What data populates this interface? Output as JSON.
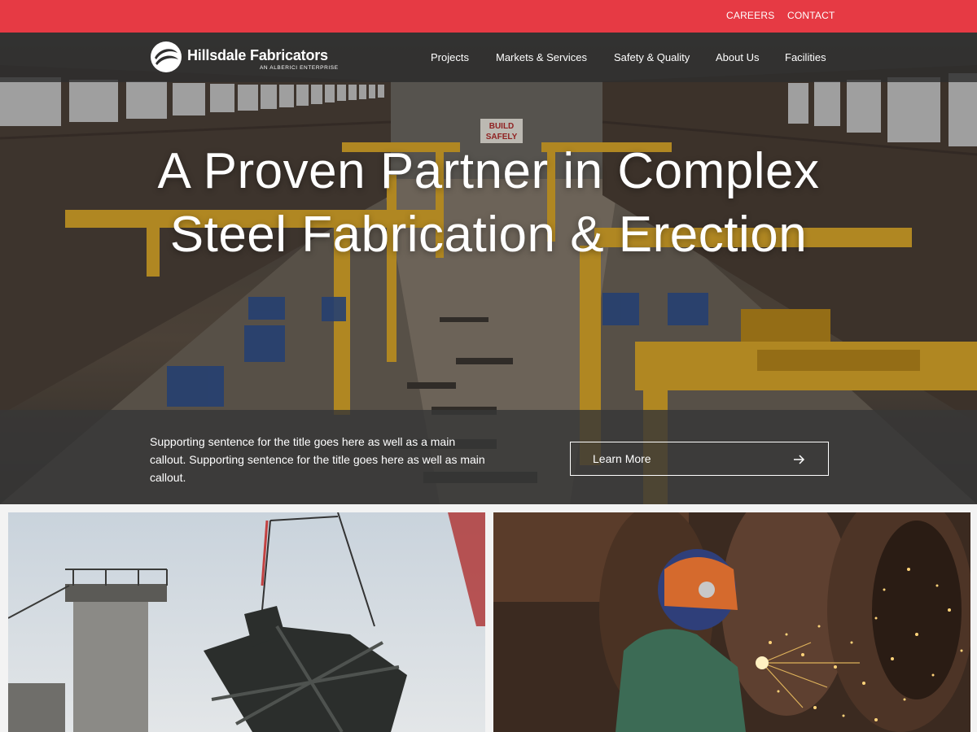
{
  "utility": {
    "links": [
      "CAREERS",
      "CONTACT"
    ]
  },
  "header": {
    "logo_name": "Hillsdale Fabricators",
    "logo_tagline": "AN ALBERICI ENTERPRISE",
    "nav": [
      "Projects",
      "Markets & Services",
      "Safety & Quality",
      "About Us",
      "Facilities"
    ]
  },
  "hero": {
    "title_line1": "A Proven Partner in Complex",
    "title_line2": "Steel Fabrication & Erection",
    "sign_text_1": "BUILD",
    "sign_text_2": "SAFELY",
    "callout_text": "Supporting sentence for the title goes here as well as a main callout. Supporting sentence for the title goes here as well as main callout.",
    "cta_label": "Learn More",
    "cta_icon": "arrow-right-icon"
  },
  "colors": {
    "brand_red": "#e63a44",
    "nav_bg": "#2d2d2d",
    "crane_yellow": "#d7a52a"
  }
}
